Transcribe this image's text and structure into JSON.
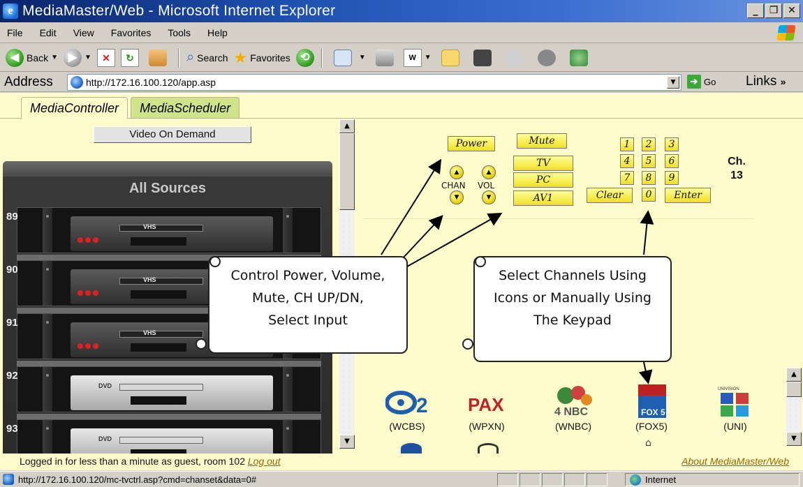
{
  "window": {
    "title": "MediaMaster/Web - Microsoft Internet Explorer",
    "buttons": [
      "_",
      "̅",
      "×"
    ]
  },
  "menu": [
    "File",
    "Edit",
    "View",
    "Favorites",
    "Tools",
    "Help"
  ],
  "toolbar": {
    "back_label": "Back",
    "search_label": "Search",
    "favorites_label": "Favorites"
  },
  "address": {
    "label": "Address",
    "url": "http://172.16.100.120/app.asp",
    "go_label": "Go",
    "links_label": "Links"
  },
  "page": {
    "tabs": [
      {
        "label": "MediaController",
        "active": true
      },
      {
        "label": "MediaScheduler",
        "active": false
      }
    ],
    "vod_button": "Video On Demand",
    "rack": {
      "title": "All Sources",
      "slots": [
        {
          "number": "89",
          "type": "VHS",
          "label": "VHS"
        },
        {
          "number": "90",
          "type": "VHS",
          "label": "VHS"
        },
        {
          "number": "91",
          "type": "VHS",
          "label": "VHS"
        },
        {
          "number": "92",
          "type": "DVD",
          "label": "DVD"
        },
        {
          "number": "93",
          "type": "DVD",
          "label": "DVD"
        }
      ]
    },
    "remote": {
      "power": "Power",
      "mute": "Mute",
      "tv": "TV",
      "pc": "PC",
      "av1": "AV1",
      "chan": "CHAN",
      "vol": "VOL",
      "keys": [
        "1",
        "2",
        "3",
        "4",
        "5",
        "6",
        "7",
        "8",
        "9"
      ],
      "clear": "Clear",
      "zero": "0",
      "enter": "Enter",
      "ch_label": "Ch.",
      "ch_value": "13"
    },
    "callouts": {
      "left": [
        "Control Power, Volume,",
        "Mute, CH UP/DN,",
        "Select Input"
      ],
      "right": [
        "Select Channels Using",
        "Icons or Manually Using",
        "The Keypad"
      ]
    },
    "channels": [
      {
        "logo": "2",
        "caption": "(WCBS)"
      },
      {
        "logo": "PAX",
        "caption": "(WPXN)"
      },
      {
        "logo": "4 NBC",
        "caption": "(WNBC)"
      },
      {
        "logo": "FOX 5",
        "caption": "(FOX5)"
      },
      {
        "logo": "UNIVISION",
        "caption": "(UNI)"
      }
    ],
    "footer": {
      "status_text": "Logged in for less than a minute as guest, room 102",
      "logout": "Log out",
      "about": "About MediaMaster/Web"
    }
  },
  "status": {
    "url": "http://172.16.100.120/mc-tvctrl.asp?cmd=chanset&data=0#",
    "zone": "Internet"
  },
  "colors": {
    "titlebar": "#0a246a",
    "page_bg": "#fffccc",
    "button_yellow": "#f0e020",
    "tab_inactive": "#cfe38a",
    "link": "#996600"
  }
}
